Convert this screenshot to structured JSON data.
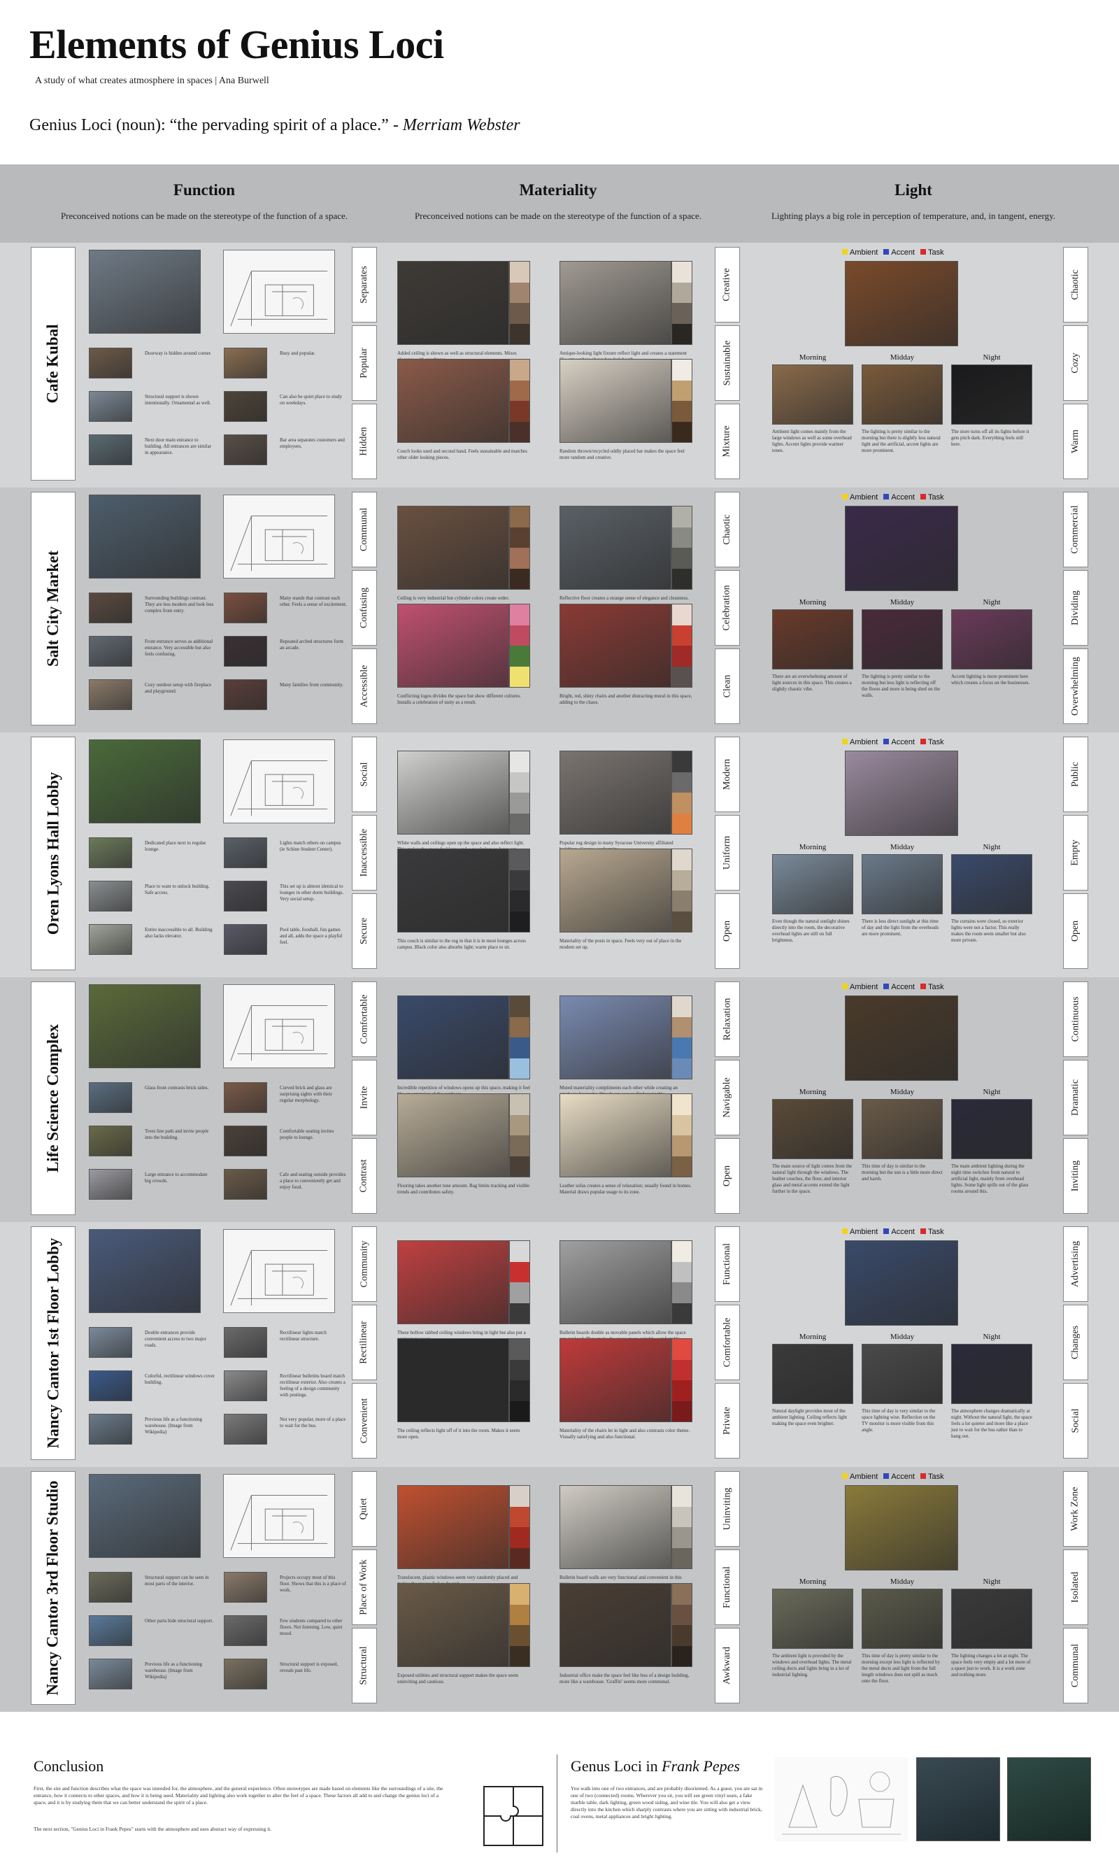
{
  "header": {
    "title": "Elements of Genius Loci",
    "subtitle": "A study of what creates atmosphere in spaces | Ana Burwell",
    "definition_text": "Genius Loci (noun): “the pervading spirit of a place.” - ",
    "definition_source": "Merriam Webster"
  },
  "columns": [
    {
      "heading": "Function",
      "desc": "Preconceived notions can be made on the stereotype of the function of a space."
    },
    {
      "heading": "Materiality",
      "desc": "Preconceived notions can be made on the stereotype of the function of a space."
    },
    {
      "heading": "Light",
      "desc": "Lighting plays a big role in perception of temperature, and, in tangent, energy."
    }
  ],
  "legend": {
    "ambient": "Ambient",
    "accent": "Accent",
    "task": "Task"
  },
  "times": [
    "Morning",
    "Midday",
    "Night"
  ],
  "colors": {
    "ambient": "#f2d21c",
    "accent": "#3347b8",
    "task": "#d92a2a",
    "row_light": "#d4d5d7",
    "row_dark": "#c4c5c7"
  },
  "places": [
    {
      "name": "Cafe Kubal",
      "function_tags": [
        "Separates",
        "Popular",
        "Hidden"
      ],
      "material_tags": [
        "Creative",
        "Sustainable",
        "Mixture"
      ],
      "light_tags": [
        "Chaotic",
        "Cozy",
        "Warm"
      ],
      "fn_captions": [
        "Doorway is hidden around corner.",
        "Busy and popular.",
        "Structural support is shown intentionally. Ornamental as well.",
        "Can also be quiet place to study on weekdays.",
        "Next door main entrance to building. All entrances are similar in appearance.",
        "Bar area separates customers and employees."
      ],
      "mat_captions": [
        "Added ceiling is shown as well as structural elements. Mixes elegance with roughness.",
        "Antique-looking light fixture reflect light and creates a statement like atmosphere above bar dark booth.",
        "Couch looks used and second hand. Feels sustainable and matches other older looking pieces.",
        "Random thrown/recycled oddly placed bar makes the space feel more random and creative."
      ],
      "light_captions": [
        "Ambient light comes mainly from the large windows as well as some overhead lights. Accent lights provide warmer tones.",
        "The lighting is pretty similar to the morning but there is slightly less natural light and the artificial, accent lights are more prominent.",
        "The store turns off all its lights before it gets pitch dark. Everything feels still here."
      ],
      "swatches": [
        [
          "#d8c8b8",
          "#a08470",
          "#6e5a4a",
          "#3e342c"
        ],
        [
          "#e8e2d8",
          "#b0a89a",
          "#6a6258",
          "#2a2622"
        ],
        [
          "#c8a888",
          "#9e6a4a",
          "#7a3828",
          "#4a3028"
        ],
        [
          "#f0ebe4",
          "#c0a070",
          "#7a5a3a",
          "#3a2a1e"
        ]
      ],
      "photo_colors": {
        "fn": "#6f7a86",
        "fn_small": [
          "#6c5a48",
          "#8a6e52",
          "#7b8894",
          "#4e4438",
          "#5a6a72",
          "#584e46"
        ],
        "mat": [
          "#3e3a36",
          "#a09a92",
          "#8a5a48",
          "#d8d0c4"
        ],
        "light_main": "#7a4a2a",
        "light_times": [
          "#8a6a4a",
          "#7a5a3a",
          "#1a1a1c"
        ]
      }
    },
    {
      "name": "Salt City Market",
      "function_tags": [
        "Communal",
        "Confusing",
        "Accessible"
      ],
      "material_tags": [
        "Chaotic",
        "Celebration",
        "Clean"
      ],
      "light_tags": [
        "Commercial",
        "Dividing",
        "Overwhelming"
      ],
      "fn_captions": [
        "Surrounding buildings contrast. They are less modern and look less complex from entry.",
        "Many stands that contrast each other. Feels a sense of excitement.",
        "Front entrance serves as additional entrance. Very accessible but also feels confusing.",
        "Repeated arched structures form an arcade.",
        "Cozy outdoor setup with fireplace and playground.",
        "Many families from community."
      ],
      "mat_captions": [
        "Ceiling is very industrial but cylinder colors create order.",
        "Reflective floor creates a strange sense of elegance and cleanness.",
        "Conflicting logos divides the space but show different cultures. Installs a celebration of unity as a result.",
        "Bright, red, shiny chairs and another distracting mural in this space, adding to the chaos."
      ],
      "light_captions": [
        "There are an overwhelming amount of light sources in this space. This creates a slightly chaotic vibe.",
        "The lighting is pretty similar to the morning but less light is reflecting off the floors and more is being shed on the walls.",
        "Accent lighting is more prominent here which creates a focus on the businesses."
      ],
      "swatches": [
        [
          "#8a6a4a",
          "#5a4030",
          "#a07058",
          "#3a2a20"
        ],
        [
          "#b0b0a8",
          "#8a8a84",
          "#5a5a56",
          "#2e2e2c"
        ],
        [
          "#e080a0",
          "#c04a60",
          "#4a7a3a",
          "#f0e070"
        ],
        [
          "#e8d8d0",
          "#c84030",
          "#a02a28",
          "#5a5050"
        ]
      ],
      "photo_colors": {
        "fn": "#4e5e6c",
        "fn_small": [
          "#5a4a40",
          "#7a5040",
          "#606870",
          "#3a3034",
          "#8a7a68",
          "#5a3e3a"
        ],
        "mat": [
          "#6a5040",
          "#5a6066",
          "#c05070",
          "#8a3a34"
        ],
        "light_main": "#3a2a4a",
        "light_times": [
          "#6a3a2a",
          "#4a2a3a",
          "#6a3a5a"
        ]
      }
    },
    {
      "name": "Oren Lyons Hall Lobby",
      "function_tags": [
        "Social",
        "Inaccessible",
        "Secure"
      ],
      "material_tags": [
        "Modern",
        "Uniform",
        "Open"
      ],
      "light_tags": [
        "Public",
        "Empty",
        "Open"
      ],
      "fn_captions": [
        "Dedicated place next to regular lounge.",
        "Lights match others on campus (ie Schine Student Center).",
        "Place to want to unlock building. Safe access.",
        "This set up is almost identical to lounges in other dorm buildings. Very social setup.",
        "Entire inaccessible to all. Building also lacks elevator.",
        "Pool table, foosball, fun games and all, adds the space a playful feel."
      ],
      "mat_captions": [
        "White walls and ceilings open up the space and also reflect light. This makes the space feel large and a good place to hang out.",
        "Popular rug design in many Syracuse University affiliated buildings. Creates conformity.",
        "This couch is similar to the rug in that it is in most lounges across campus. Black color also absorbs light; warm place to sit.",
        "Materiality of the posts in space. Feels very out of place in the modern set up."
      ],
      "light_captions": [
        "Even though the natural sunlight shines directly into the room, the decorative overhead lights are still on full brightness.",
        "There is less direct sunlight at this time of day and the light from the overheads are more prominent.",
        "The curtains were closed, so exterior lights were not a factor. This really makes the room seem smaller but also more private."
      ],
      "swatches": [
        [
          "#e6e6e4",
          "#c6c6c4",
          "#9a9a98",
          "#6a6a68"
        ],
        [
          "#3a3a3a",
          "#6a6a6a",
          "#c09060",
          "#e08040"
        ],
        [
          "#5a5a5c",
          "#3a3a3c",
          "#2a2a2c",
          "#1e1e20"
        ],
        [
          "#e0d8cc",
          "#b8ac9a",
          "#8a7e6c",
          "#5a4e40"
        ]
      ],
      "photo_colors": {
        "fn": "#4a6a3a",
        "fn_small": [
          "#6a7a5a",
          "#5a6068",
          "#8a8e90",
          "#4a4a50",
          "#a0a49a",
          "#5a5a68"
        ],
        "mat": [
          "#d0d0ce",
          "#7a7470",
          "#3a3a3c",
          "#b8a890"
        ],
        "light_main": "#9a8a9e",
        "light_times": [
          "#7a8a9a",
          "#6a7a8a",
          "#3a4a6a"
        ]
      }
    },
    {
      "name": "Life Science Complex",
      "function_tags": [
        "Comfortable",
        "Invite",
        "Contrast"
      ],
      "material_tags": [
        "Relaxation",
        "Navigable",
        "Open"
      ],
      "light_tags": [
        "Continuous",
        "Dramatic",
        "Inviting"
      ],
      "fn_captions": [
        "Glass front contrasts brick sides.",
        "Curved brick and glass are surprising sights with their regular morphology.",
        "Trees line path and invite people into the building.",
        "Comfortable seating invites people to lounge.",
        "Large entrance to accommodate big crowds.",
        "Cafe and seating outside provides a place to conveniently get and enjoy food."
      ],
      "mat_captions": [
        "Incredible repetition of windows opens up this space, making it feel like an extension of the outdoors.",
        "Muted materiality compliments each other while creating an emphasis hierarchy. Woods are easy to find navigable.",
        "Flooring takes another tone amount. Bag limits tracking and visible trends and contributes safety.",
        "Leather sofas creates a sense of relaxation; usually found in homes. Material draws popular usage to its zone."
      ],
      "light_captions": [
        "The main source of light comes from the natural light through the windows. The leather couches, the floor, and interior glass and metal accents extend the light further in the space.",
        "This time of day is similar to the morning but the sun is a little more direct and harsh.",
        "The main ambient lighting during the night time switches from natural to artificial light, mainly from overhead lights. Some light spills out of the glass rooms around this."
      ],
      "swatches": [
        [
          "#5a4a3a",
          "#8a6a4a",
          "#3a5a8a",
          "#9ac0e0"
        ],
        [
          "#e0d8cc",
          "#b09070",
          "#4a78b0",
          "#6a8ab8"
        ],
        [
          "#c8c0b0",
          "#a89880",
          "#7a6a58",
          "#4a4038"
        ],
        [
          "#f0e4cc",
          "#d8c4a0",
          "#b89870",
          "#7a6044"
        ]
      ],
      "photo_colors": {
        "fn": "#5a6a3a",
        "fn_small": [
          "#5a6e80",
          "#7a5a48",
          "#6a6a4a",
          "#4a4038",
          "#9a9aa0",
          "#6a5a48"
        ],
        "mat": [
          "#3a4a6a",
          "#7a8ab0",
          "#b8ac98",
          "#e8dcc4"
        ],
        "light_main": "#4a3a2a",
        "light_times": [
          "#5a4a38",
          "#6a5a48",
          "#2a2a3a"
        ]
      }
    },
    {
      "name": "Nancy Cantor 1st Floor Lobby",
      "function_tags": [
        "Community",
        "Rectilinear",
        "Convenient"
      ],
      "material_tags": [
        "Functional",
        "Comfortable",
        "Private"
      ],
      "light_tags": [
        "Advertising",
        "Changes",
        "Social"
      ],
      "fn_captions": [
        "Double entrances provide convenient access to two major roads.",
        "Rectilinear lights match rectilinear structure.",
        "Colorful, rectilinear windows cover building.",
        "Rectilinear bulletins board match rectilinear exterior. Also creates a feeling of a design community with postings.",
        "Previous life as a functioning warehouse. (Image from Wikipedia)",
        "Not very popular, more of a place to wait for the bus."
      ],
      "mat_captions": [
        "These hollow tabbed ceiling windows bring in light but also put a contrast message.",
        "Bulletin boards double as movable panels which allow the space can get loud. They make the space more suitably comfortable.",
        "The ceiling reflects light off of it into the room. Makes it seem more open.",
        "Materiality of the chairs let in light and also contrasts color theme. Visually satisfying and also functional."
      ],
      "light_captions": [
        "Natural daylight provides most of the ambient lighting. Ceiling reflects light making the space even brighter.",
        "This time of day is very similar to the space lighting wise. Reflection on the TV monitor is more visible from this angle.",
        "The atmosphere changes dramatically at night. Without the natural light, the space feels a lot quieter and more like a place just to wait for the bus rather than to hang out."
      ],
      "swatches": [
        [
          "#d8d8d8",
          "#c83030",
          "#a0a0a0",
          "#3a3a3a"
        ],
        [
          "#f0ece4",
          "#c0c0c0",
          "#8a8a8a",
          "#3a3a3a"
        ],
        [
          "#5a5a5a",
          "#3a3a3a",
          "#2a2a2a",
          "#1a1a1a"
        ],
        [
          "#e04a40",
          "#c03030",
          "#a02020",
          "#7a1a1a"
        ]
      ],
      "photo_colors": {
        "fn": "#4a5a7a",
        "fn_small": [
          "#7a8a9a",
          "#6a6a6a",
          "#3a5a8a",
          "#8a8a8a",
          "#6a7a8a",
          "#7a7a7a"
        ],
        "mat": [
          "#c04040",
          "#a0a0a0",
          "#2a2a2a",
          "#c03a3a"
        ],
        "light_main": "#3a4a6a",
        "light_times": [
          "#3a3a3a",
          "#4a4a4a",
          "#2a2a3a"
        ]
      }
    },
    {
      "name": "Nancy Cantor 3rd Floor Studio",
      "function_tags": [
        "Quiet",
        "Place of Work",
        "Structural"
      ],
      "material_tags": [
        "Uninviting",
        "Functional",
        "Awkward"
      ],
      "light_tags": [
        "Work Zone",
        "Isolated",
        "Communal"
      ],
      "fn_captions": [
        "Structural support can be seen in most parts of the interior.",
        "Projects occupy most of this floor. Shows that this is a place of work.",
        "Other parts hide structural support.",
        "Few students compared to other floors. Not listening. Low, quiet mood.",
        "Previous life as a functioning warehouse. (Image from Wikipedia)",
        "Structural support is exposed, reveals past life."
      ],
      "mat_captions": [
        "Translucent, plastic windows seem very randomly placed and makes the spaces feel awkward.",
        "Bulletin board walls are very functional and convenient in this space.",
        "Exposed utilities and structural support makes the space seem uninviting and cautious.",
        "Industrial office make the space feel like less of a design building, more like a warehouse. 'Graffiti' seems more communal."
      ],
      "light_captions": [
        "The ambient light is provided by the windows and overhead lights. The metal ceiling ducts and lights bring in a lot of industrial lighting.",
        "This time of day is pretty similar to the morning except less light is reflected by the metal ducts and light from the full length windows does not spill as much onto the floor.",
        "The lighting changes a lot at night. The space feels very empty and a lot more of a space just to work. It is a work zone and nothing more."
      ],
      "swatches": [
        [
          "#d8d0c8",
          "#c04830",
          "#a02a20",
          "#5a2a20"
        ],
        [
          "#e8e4dc",
          "#c8c4bc",
          "#9a968e",
          "#6a665e"
        ],
        [
          "#d8b070",
          "#b08040",
          "#6a5030",
          "#3a2e22"
        ],
        [
          "#8a7058",
          "#6a5040",
          "#4a3a2e",
          "#2a221c"
        ]
      ],
      "photo_colors": {
        "fn": "#5a6a7a",
        "fn_small": [
          "#6a6a5a",
          "#8a7a6a",
          "#5a7a9a",
          "#6a6a6a",
          "#7a8a9a",
          "#7a7060"
        ],
        "mat": [
          "#c05030",
          "#d0ccc4",
          "#6a5a48",
          "#4a3e34"
        ],
        "light_main": "#8a7a3a",
        "light_times": [
          "#6a6a5a",
          "#5a5a4a",
          "#3a3a3a"
        ]
      }
    }
  ],
  "conclusion": {
    "title": "Conclusion",
    "body": "First, the site and function describes what the space was intended for, the atmosphere, and the general experience. Often stereotypes are made based on elements like the surroundings of a site, the entrance, how it connects to other spaces, and how it is being used. Materiality and lighting also work together to alter the feel of a space. These factors all add to and change the genius loci of a space, and it is by studying them that we can better understand the spirit of a place.",
    "note": "The next section, \"Genius Loci in Frank Pepes\" starts with the atmosphere and uses abstract way of expressing it."
  },
  "pepes": {
    "title_text": "Genus Loci in ",
    "title_em": "Frank Pepes",
    "body": "You walk into one of two entrances, and are probably disoriented. As a guest, you are sat in one of two (connected) rooms. Wherever you sit, you will see green vinyl seats, a fake marble table, dark lighting, green wood siding, and wine tile. You will also get a view directly into the kitchen which sharply contrasts where you are sitting with industrial brick, coal ovens, metal appliances and bright lighting."
  }
}
